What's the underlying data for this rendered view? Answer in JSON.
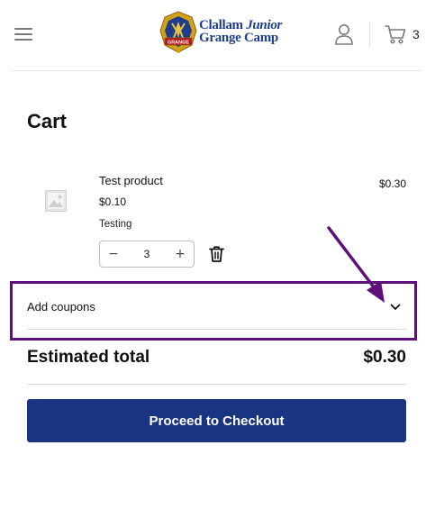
{
  "header": {
    "logo_line1_prefix": "Clallam ",
    "logo_line1_italic": "Junior",
    "logo_line2": "Grange Camp",
    "badge_text": "GRANGE",
    "cart_count": "3"
  },
  "cart": {
    "title": "Cart",
    "items": [
      {
        "name": "Test product",
        "unit_price": "$0.10",
        "description": "Testing",
        "quantity": "3",
        "line_total": "$0.30"
      }
    ],
    "qty_minus": "−",
    "qty_plus": "+",
    "coupons_label": "Add coupons",
    "estimated_total_label": "Estimated total",
    "estimated_total_value": "$0.30",
    "checkout_label": "Proceed to Checkout"
  },
  "colors": {
    "brand_blue": "#193581",
    "annotation_purple": "#5e0f7a",
    "logo_gold": "#d4a017"
  },
  "icons": {
    "menu": "hamburger-menu-icon",
    "account": "user-account-icon",
    "cart": "shopping-cart-icon",
    "product_placeholder": "image-placeholder-icon",
    "remove": "trash-icon",
    "expand": "chevron-down-icon"
  }
}
